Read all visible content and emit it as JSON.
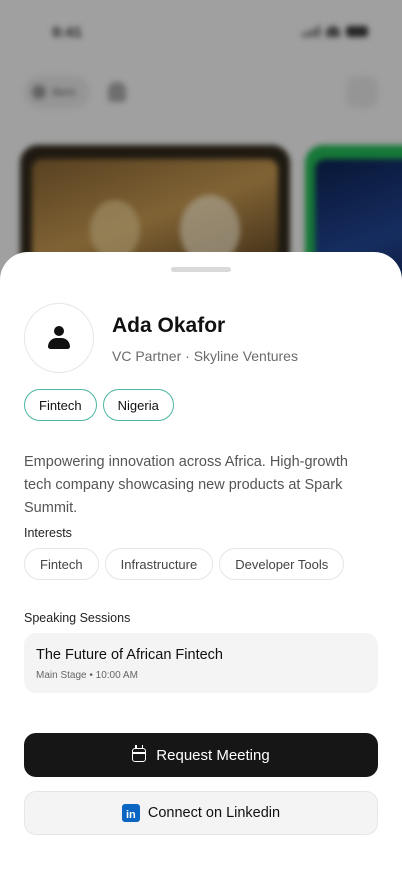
{
  "background": {
    "status_time": "9:41",
    "filter_label": "Item"
  },
  "profile": {
    "name": "Ada Okafor",
    "subtitle": "VC Partner · Skyline Ventures",
    "tags": [
      "Fintech",
      "Nigeria"
    ],
    "bio": "Empowering innovation across Africa. High-growth tech company showcasing new products at Spark Summit."
  },
  "interests": {
    "label": "Interests",
    "items": [
      "Fintech",
      "Infrastructure",
      "Developer Tools"
    ]
  },
  "sessions": {
    "label": "Speaking Sessions",
    "items": [
      {
        "title": "The Future of African Fintech",
        "meta": "Main Stage • 10:00 AM"
      }
    ]
  },
  "actions": {
    "request_meeting": "Request Meeting",
    "connect_linkedin": "Connect on Linkedin",
    "linkedin_glyph": "in"
  },
  "colors": {
    "tag_border": "#4ab5a2",
    "primary_button": "#161616",
    "linkedin": "#0a66c2"
  }
}
